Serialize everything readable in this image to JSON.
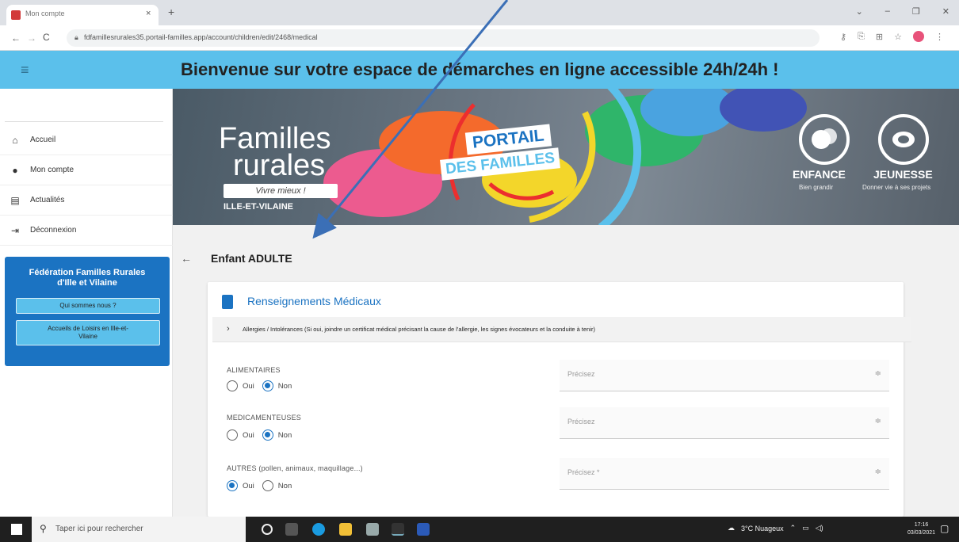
{
  "browser": {
    "tab_title": "Mon compte",
    "tab_close": "×",
    "new_tab": "+",
    "url": "fdfamillesrurales35.portail-familles.app/account/children/edit/2468/medical",
    "window_controls": [
      "⌄",
      "–",
      "❐",
      "✕"
    ]
  },
  "header": {
    "menu_icon": "hamburger-icon",
    "welcome": "Bienvenue sur votre espace de démarches en ligne accessible 24h/24h !"
  },
  "sidebar": {
    "items": [
      {
        "label": "Accueil",
        "icon": "home-icon"
      },
      {
        "label": "Mon compte",
        "icon": "account-icon"
      },
      {
        "label": "Actualités",
        "icon": "news-icon"
      },
      {
        "label": "Déconnexion",
        "icon": "logout-icon"
      }
    ],
    "federation": {
      "title_line1": "Fédération Familles Rurales",
      "title_line2": "d'Ille et Vilaine",
      "button1": "Qui sommes nous ?",
      "button2_line1": "Accueils de Loisirs en Ille-et-",
      "button2_line2": "Vilaine"
    }
  },
  "banner": {
    "logo_line1": "Familles",
    "logo_line2": "rurales",
    "logo_tagline": "Vivre mieux !",
    "logo_region": "ILLE-ET-VILAINE",
    "portail_line1": "PORTAIL",
    "portail_line2": "DES FAMILLES",
    "enfance_title": "ENFANCE",
    "enfance_sub": "Bien grandir",
    "jeunesse_title": "JEUNESSE",
    "jeunesse_sub": "Donner vie à ses projets"
  },
  "main": {
    "back_icon": "arrow-left-icon",
    "page_title": "Enfant ADULTE",
    "card_title": "Renseignements Médicaux",
    "accordion_chevron": "›",
    "accordion_text": "Allergies / Intolérances (Si oui, joindre un certificat médical précisant la cause de l'allergie, les signes évocateurs et la conduite à tenir)",
    "rows": [
      {
        "label": "ALIMENTAIRES",
        "oui": "Oui",
        "non": "Non",
        "selected": "Non",
        "placeholder": "Précisez"
      },
      {
        "label": "MEDICAMENTEUSES",
        "oui": "Oui",
        "non": "Non",
        "selected": "Non",
        "placeholder": "Précisez"
      },
      {
        "label": "AUTRES (pollen, animaux, maquillage...)",
        "oui": "Oui",
        "non": "Non",
        "selected": "Oui",
        "placeholder": "Précisez *"
      }
    ]
  },
  "taskbar": {
    "search_placeholder": "Taper ici pour rechercher",
    "weather": "3°C Nuageux",
    "time": "17:16",
    "date": "03/03/2021"
  },
  "colors": {
    "header": "#5bc0eb",
    "primary": "#1b73c2",
    "annotation_arrow": "#3b6fb6"
  }
}
